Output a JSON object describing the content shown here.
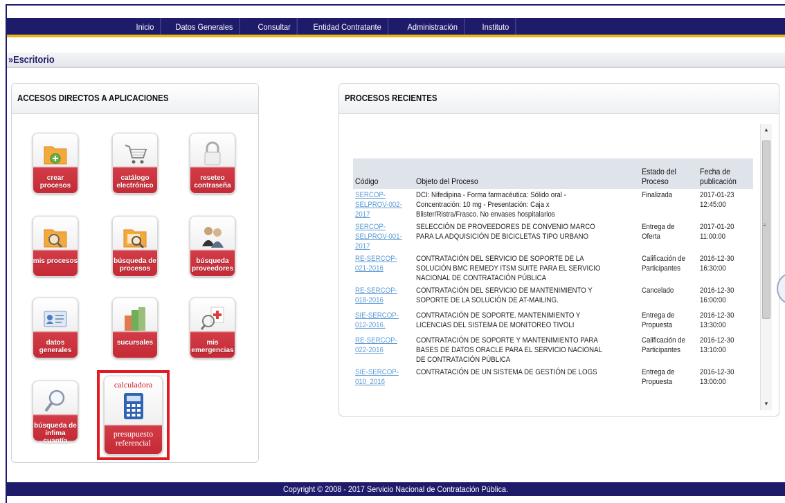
{
  "nav": {
    "items": [
      "Inicio",
      "Datos Generales",
      "Consultar",
      "Entidad Contratante",
      "Administración",
      "Instituto"
    ]
  },
  "breadcrumb": "»Escritorio",
  "left_panel": {
    "title": "ACCESOS DIRECTOS A APLICACIONES",
    "tiles": [
      {
        "label": "crear procesos",
        "icon": "folder-add-icon"
      },
      {
        "label": "catálogo electrónico",
        "icon": "shopping-cart-icon"
      },
      {
        "label": "reseteo contraseña",
        "icon": "padlock-icon"
      },
      {
        "label": "mis procesos",
        "icon": "folder-search-icon"
      },
      {
        "label": "búsqueda de procesos",
        "icon": "folder-magnifier-icon"
      },
      {
        "label": "búsqueda proveedores",
        "icon": "people-icon"
      },
      {
        "label": "datos generales",
        "icon": "id-card-icon"
      },
      {
        "label": "sucursales",
        "icon": "buildings-icon"
      },
      {
        "label": "mis emergencias",
        "icon": "emergency-icon"
      },
      {
        "label": "búsqueda de ínfima cuantía",
        "icon": "magnifier-icon"
      }
    ],
    "calc": {
      "top": "calculadora",
      "bottom1": "presupuesto",
      "bottom2": "referencial",
      "icon": "calculator-icon"
    }
  },
  "right_panel": {
    "title": "PROCESOS RECIENTES",
    "columns": [
      "Código",
      "Objeto del Proceso",
      "Estado del Proceso",
      "Fecha de publicación"
    ],
    "rows": [
      {
        "code": "SERCOP-SELPROV-002-2017",
        "object": "DCI: Nifedipina - Forma farmacéutica: Sólido oral - Concentración: 10 mg - Presentación: Caja x Blister/Ristra/Frasco. No envases hospitalarios",
        "status": "Finalizada",
        "date": "2017-01-23 12:45:00"
      },
      {
        "code": "SERCOP-SELPROV-001-2017",
        "object": "SELECCIÓN DE PROVEEDORES DE CONVENIO MARCO PARA LA ADQUISICIÓN DE BICICLETAS TIPO URBANO",
        "status": "Entrega de Oferta",
        "date": "2017-01-20 11:00:00"
      },
      {
        "code": "RE-SERCOP-021-2016",
        "object": "CONTRATACIÓN DEL SERVICIO DE SOPORTE DE LA SOLUCIÓN BMC REMEDY ITSM SUITE PARA EL SERVICIO NACIONAL DE CONTRATACIÓN PÚBLICA",
        "status": "Calificación de Participantes",
        "date": "2016-12-30 16:30:00"
      },
      {
        "code": "RE-SERCOP-018-2016",
        "object": "CONTRATACIÓN DEL SERVICIO DE MANTENIMIENTO Y SOPORTE DE LA SOLUCIÓN DE AT-MAILING.",
        "status": "Cancelado",
        "date": "2016-12-30 16:00:00"
      },
      {
        "code": "SIE-SERCOP-012-2016.",
        "object": "CONTRATACIÓN DE SOPORTE. MANTENIMIENTO Y LICENCIAS DEL SISTEMA DE MONITOREO TIVOLI",
        "status": "Entrega de Propuesta",
        "date": "2016-12-30 13:30:00"
      },
      {
        "code": "RE-SERCOP-022-2016",
        "object": "CONTRATACIÓN DE SOPORTE Y MANTENIMIENTO PARA BASES DE DATOS ORACLE PARA EL SERVICIO NACIONAL DE CONTRATACIÓN PÚBLICA",
        "status": "Calificación de Participantes",
        "date": "2016-12-30 13:10:00"
      },
      {
        "code": "SIE-SERCOP-010_2016",
        "object": "CONTRATACIÓN DE UN SISTEMA DE GESTIÓN DE LOGS",
        "status": "Entrega de Propuesta",
        "date": "2016-12-30 13:00:00"
      }
    ]
  },
  "footer": "Copyright © 2008 - 2017 Servicio Nacional de Contratación Pública."
}
